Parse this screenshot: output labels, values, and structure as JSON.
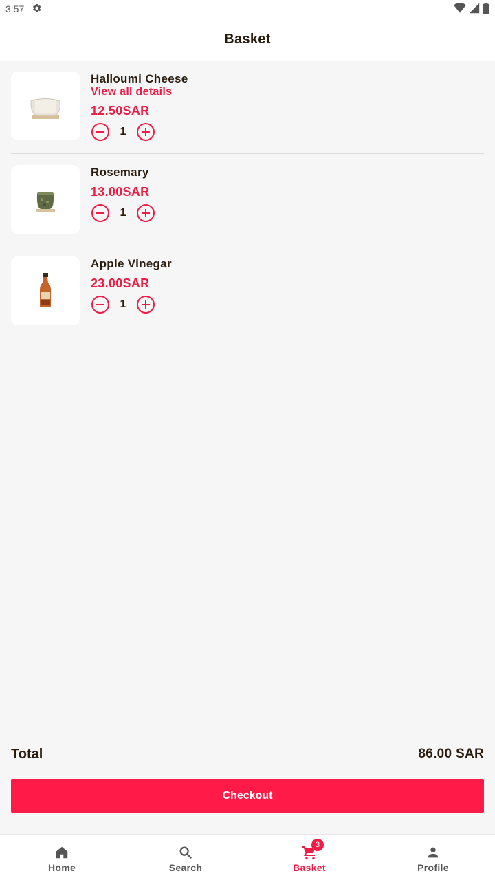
{
  "status_bar": {
    "time": "3:57"
  },
  "header": {
    "title": "Basket"
  },
  "items": [
    {
      "name": "Halloumi Cheese",
      "link": "View all details",
      "price": "12.50SAR",
      "qty": "1"
    },
    {
      "name": "Rosemary",
      "price": "13.00SAR",
      "qty": "1"
    },
    {
      "name": "Apple Vinegar",
      "price": "23.00SAR",
      "qty": "1"
    }
  ],
  "summary": {
    "total_label": "Total",
    "total_value": "86.00 SAR"
  },
  "checkout": {
    "label": "Checkout"
  },
  "nav": {
    "items": [
      {
        "label": "Home",
        "icon": "home-icon"
      },
      {
        "label": "Search",
        "icon": "search-icon"
      },
      {
        "label": "Basket",
        "icon": "cart-icon",
        "badge": "3",
        "active": true
      },
      {
        "label": "Profile",
        "icon": "person-icon"
      }
    ]
  },
  "colors": {
    "accent": "#ee1c47",
    "button": "#ff1a48",
    "text": "#2b1d0e",
    "background": "#f6f6f6"
  }
}
